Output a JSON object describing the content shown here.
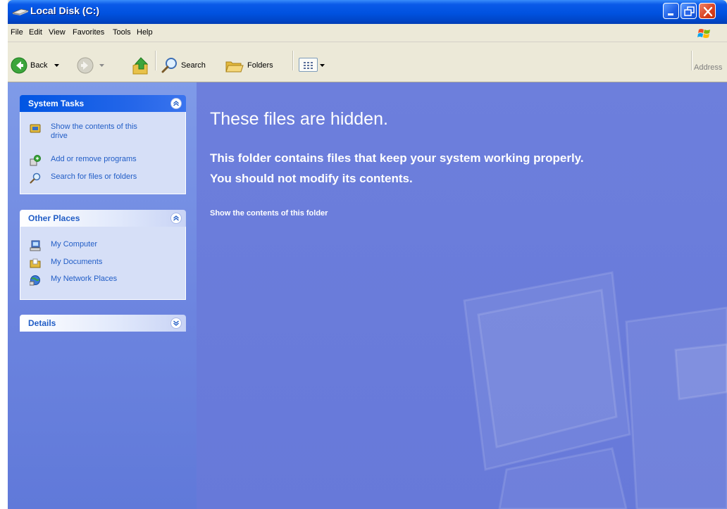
{
  "window": {
    "title": "Local Disk (C:)",
    "colors": {
      "titlebar": "#0052e0",
      "content_bg": "#6a82de",
      "panel_body": "#d6dff7",
      "link": "#215dc6"
    }
  },
  "menubar": {
    "items": [
      "File",
      "Edit",
      "View",
      "Favorites",
      "Tools",
      "Help"
    ]
  },
  "toolbar": {
    "back_label": "Back",
    "search_label": "Search",
    "folders_label": "Folders",
    "address_label": "Address"
  },
  "sidebar": {
    "system_tasks": {
      "title": "System Tasks",
      "items": [
        {
          "line1": "Show the contents of this",
          "line2": "drive",
          "icon": "drive-icon"
        },
        {
          "line1": "Add or remove programs",
          "icon": "add-remove-programs-icon"
        },
        {
          "line1": "Search for files or folders",
          "icon": "search-icon"
        }
      ]
    },
    "other_places": {
      "title": "Other Places",
      "items": [
        {
          "label": "My Computer",
          "icon": "my-computer-icon"
        },
        {
          "label": "My Documents",
          "icon": "my-documents-icon"
        },
        {
          "label": "My Network Places",
          "icon": "network-places-icon"
        }
      ]
    },
    "details": {
      "title": "Details"
    }
  },
  "main": {
    "heading": "These files are hidden.",
    "message_line1": "This folder contains files that keep your system working properly.",
    "message_line2": "You should not modify its contents.",
    "show_link": "Show the contents of this folder"
  }
}
